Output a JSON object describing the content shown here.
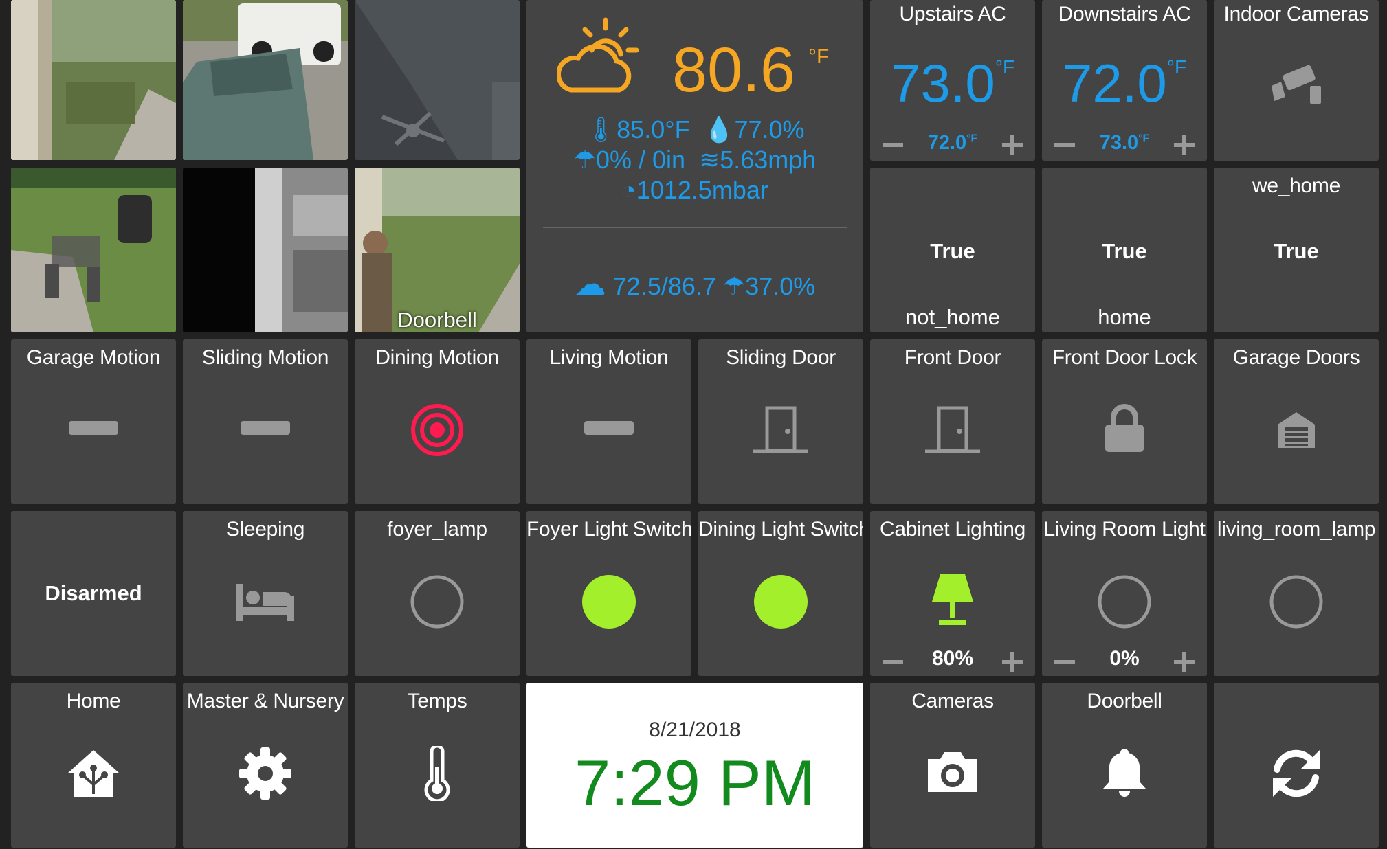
{
  "cameras": [
    {
      "name": "front-porch-cam",
      "label": ""
    },
    {
      "name": "driveway-cam",
      "label": ""
    },
    {
      "name": "ceiling-cam",
      "label": ""
    },
    {
      "name": "patio-cam",
      "label": ""
    },
    {
      "name": "hallway-cam",
      "label": ""
    },
    {
      "name": "doorbell-cam",
      "label": "Doorbell"
    }
  ],
  "weather": {
    "icon": "partly-cloudy-icon",
    "temp": "80.6",
    "unit": "°F",
    "feels_like": "85.0°F",
    "humidity": "77.0%",
    "precip": "0% / 0in",
    "wind": "5.63mph",
    "pressure": "1012.5mbar",
    "forecast_range": "72.5/86.7",
    "forecast_precip": "37.0%",
    "color_temp": "#f5a623",
    "color_info": "#1e9be8"
  },
  "ac": [
    {
      "label": "Upstairs AC",
      "current": "73.0",
      "setpoint": "72.0",
      "unit": "°F"
    },
    {
      "label": "Downstairs AC",
      "current": "72.0",
      "setpoint": "73.0",
      "unit": "°F"
    }
  ],
  "indoor_cameras": {
    "label": "Indoor Cameras",
    "icon": "security-camera-icon"
  },
  "presence": [
    {
      "label": "",
      "value": "True",
      "state": "not_home"
    },
    {
      "label": "",
      "value": "True",
      "state": "home"
    },
    {
      "label": "we_home",
      "value": "True",
      "state": ""
    }
  ],
  "sensors": [
    {
      "label": "Garage Motion",
      "icon": "dash-icon"
    },
    {
      "label": "Sliding Motion",
      "icon": "dash-icon"
    },
    {
      "label": "Dining Motion",
      "icon": "motion-active-icon"
    },
    {
      "label": "Living Motion",
      "icon": "dash-icon"
    },
    {
      "label": "Sliding Door",
      "icon": "door-icon"
    },
    {
      "label": "Front Door",
      "icon": "door-icon"
    },
    {
      "label": "Front Door Lock",
      "icon": "lock-icon"
    },
    {
      "label": "Garage Doors",
      "icon": "garage-icon"
    }
  ],
  "row3": {
    "alarm": {
      "label": "",
      "state": "Disarmed"
    },
    "sleeping": {
      "label": "Sleeping",
      "icon": "bed-icon"
    },
    "foyer_lamp": {
      "label": "foyer_lamp",
      "icon": "circle-off-icon"
    },
    "foyer_switch": {
      "label": "Foyer Light Switch",
      "icon": "circle-on-icon"
    },
    "dining_switch": {
      "label": "Dining Light Switch",
      "icon": "circle-on-icon"
    },
    "cabinet": {
      "label": "Cabinet Lighting",
      "icon": "lamp-icon",
      "level": "80%"
    },
    "living_light": {
      "label": "Living Room Light",
      "icon": "circle-off-icon",
      "level": "0%"
    },
    "living_lamp": {
      "label": "living_room_lamp",
      "icon": "circle-off-icon"
    }
  },
  "nav": {
    "home": {
      "label": "Home",
      "icon": "home-assistant-icon"
    },
    "master": {
      "label": "Master & Nursery",
      "icon": "gear-icon"
    },
    "temps": {
      "label": "Temps",
      "icon": "thermometer-icon"
    },
    "cameras": {
      "label": "Cameras",
      "icon": "camera-icon"
    },
    "doorbell": {
      "label": "Doorbell",
      "icon": "bell-icon"
    },
    "refresh": {
      "label": "",
      "icon": "refresh-icon"
    }
  },
  "clock": {
    "date": "8/21/2018",
    "time": "7:29 PM",
    "time_color": "#138a1e"
  },
  "colors": {
    "on": "#a4ef2c",
    "active": "#ff1a4f",
    "icon_off": "#999999",
    "tile": "#444444",
    "background": "#222222"
  }
}
